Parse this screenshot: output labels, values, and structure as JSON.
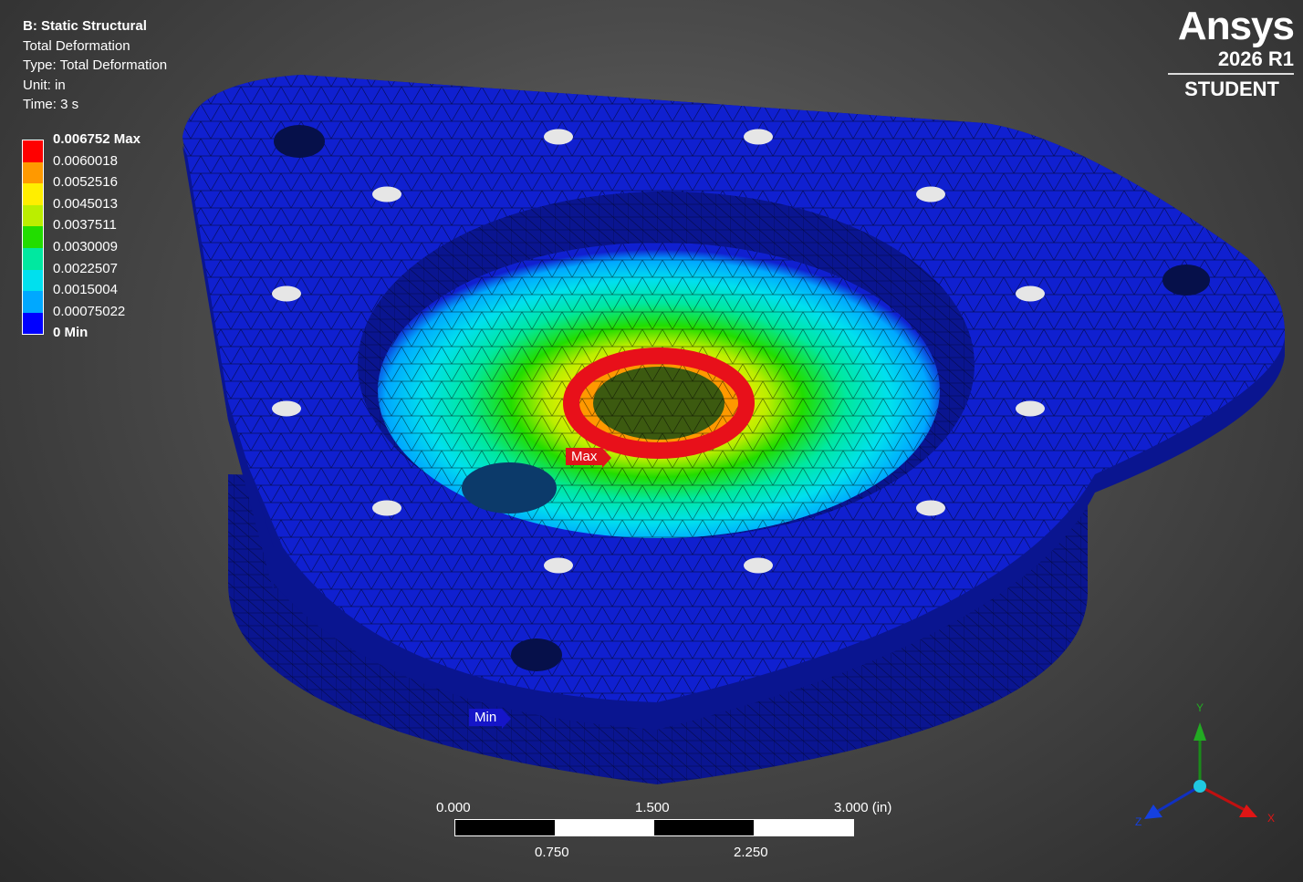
{
  "info": {
    "title": "B: Static Structural",
    "result": "Total Deformation",
    "type": "Type: Total Deformation",
    "unit": "Unit: in",
    "time": "Time: 3 s"
  },
  "legend": {
    "labels": [
      "0.006752 Max",
      "0.0060018",
      "0.0052516",
      "0.0045013",
      "0.0037511",
      "0.0030009",
      "0.0022507",
      "0.0015004",
      "0.00075022",
      "0 Min"
    ],
    "colors": [
      "#ff0000",
      "#ff9900",
      "#ffee00",
      "#bbee00",
      "#22dd00",
      "#00e8a0",
      "#00e0ee",
      "#00a8ff",
      "#0000ff"
    ]
  },
  "logo": {
    "brand": "Ansys",
    "version": "2026 R1",
    "edition": "STUDENT"
  },
  "probes": {
    "max": "Max",
    "min": "Min"
  },
  "scale_bar": {
    "top_labels": [
      "0.000",
      "1.500",
      "3.000 (in)"
    ],
    "bottom_labels": [
      "0.750",
      "2.250"
    ]
  },
  "triad": {
    "y": "Y",
    "x": "X",
    "z": "Z"
  },
  "colors": {
    "mesh_blue": "#1020d0",
    "dark_side": "#0a1590",
    "background": "#4a4a4a"
  }
}
